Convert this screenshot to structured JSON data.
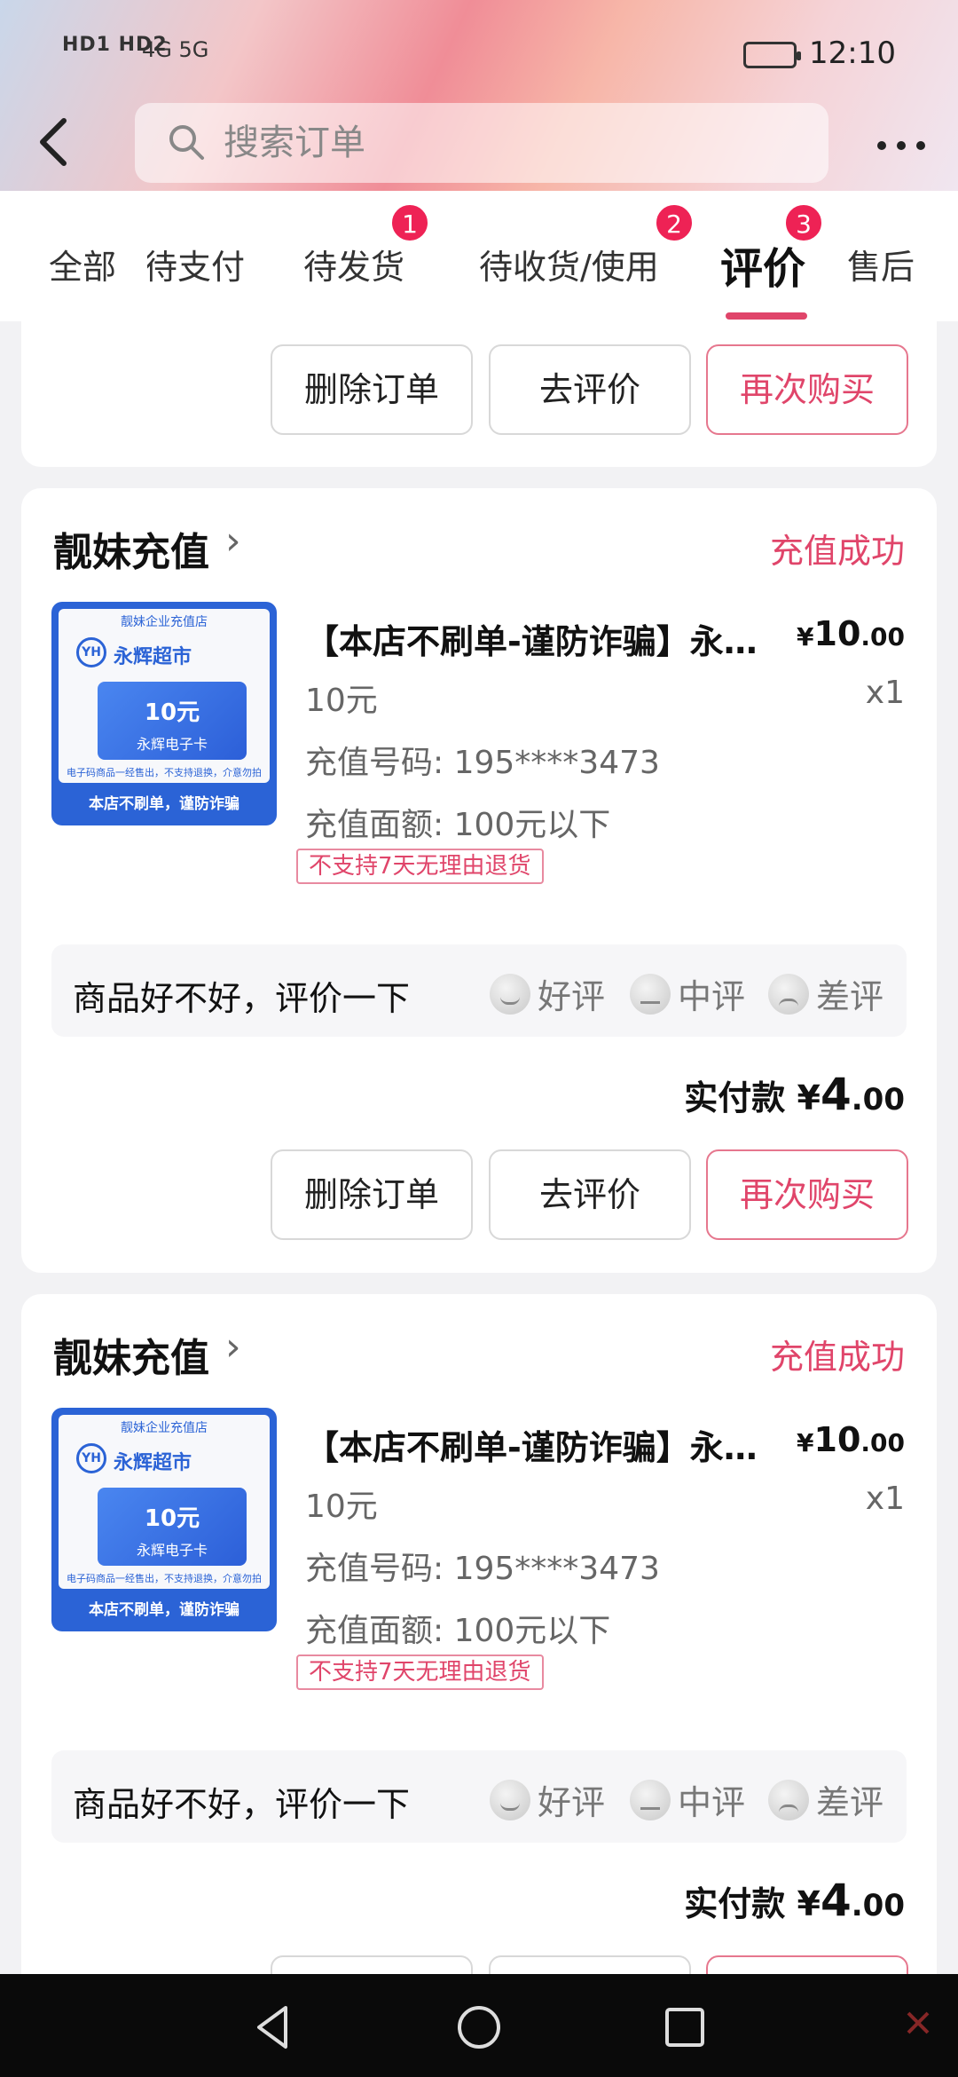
{
  "status_bar": {
    "left_labels": "HD1 HD2",
    "network": "4G 5G",
    "time": "12:10"
  },
  "header": {
    "search_placeholder": "搜索订单"
  },
  "tabs": [
    {
      "label": "全部"
    },
    {
      "label": "待支付"
    },
    {
      "label": "待发货",
      "badge": "1"
    },
    {
      "label": "待收货/使用",
      "badge": "2"
    },
    {
      "label": "评价",
      "badge": "3",
      "active": true
    },
    {
      "label": "售后"
    }
  ],
  "buttons": {
    "delete": "删除订单",
    "review": "去评价",
    "rebuy": "再次购买"
  },
  "orders": [
    {
      "store": "靓妹充值",
      "status": "充值成功",
      "thumb": {
        "top_text": "靓妹企业充值店",
        "logo": "YH",
        "brand": "永辉超市",
        "card_value": "10元",
        "card_name": "永辉电子卡",
        "note": "电子码商品一经售出，不支持退换，介意勿拍",
        "bottom_text": "本店不刷单，谨防诈骗"
      },
      "title": "【本店不刷单-谨防诈骗】永辉超市电子卡",
      "price_symbol": "¥",
      "price_int": "10",
      "price_dec": ".00",
      "spec": "10元",
      "qty": "x1",
      "recharge_number": "充值号码: 195****3473",
      "recharge_amount": "充值面额: 100元以下",
      "no_return_tag": "不支持7天无理由退货",
      "review_prompt": "商品好不好，评价一下",
      "review_good": "好评",
      "review_mid": "中评",
      "review_bad": "差评",
      "paid_label": "实付款",
      "paid_symbol": "¥",
      "paid_int": "4",
      "paid_dec": ".00"
    },
    {
      "store": "靓妹充值",
      "status": "充值成功",
      "thumb": {
        "top_text": "靓妹企业充值店",
        "logo": "YH",
        "brand": "永辉超市",
        "card_value": "10元",
        "card_name": "永辉电子卡",
        "note": "电子码商品一经售出，不支持退换，介意勿拍",
        "bottom_text": "本店不刷单，谨防诈骗"
      },
      "title": "【本店不刷单-谨防诈骗】永辉超市电子卡",
      "price_symbol": "¥",
      "price_int": "10",
      "price_dec": ".00",
      "spec": "10元",
      "qty": "x1",
      "recharge_number": "充值号码: 195****3473",
      "recharge_amount": "充值面额: 100元以下",
      "no_return_tag": "不支持7天无理由退货",
      "review_prompt": "商品好不好，评价一下",
      "review_good": "好评",
      "review_mid": "中评",
      "review_bad": "差评",
      "paid_label": "实付款",
      "paid_symbol": "¥",
      "paid_int": "4",
      "paid_dec": ".00"
    }
  ]
}
